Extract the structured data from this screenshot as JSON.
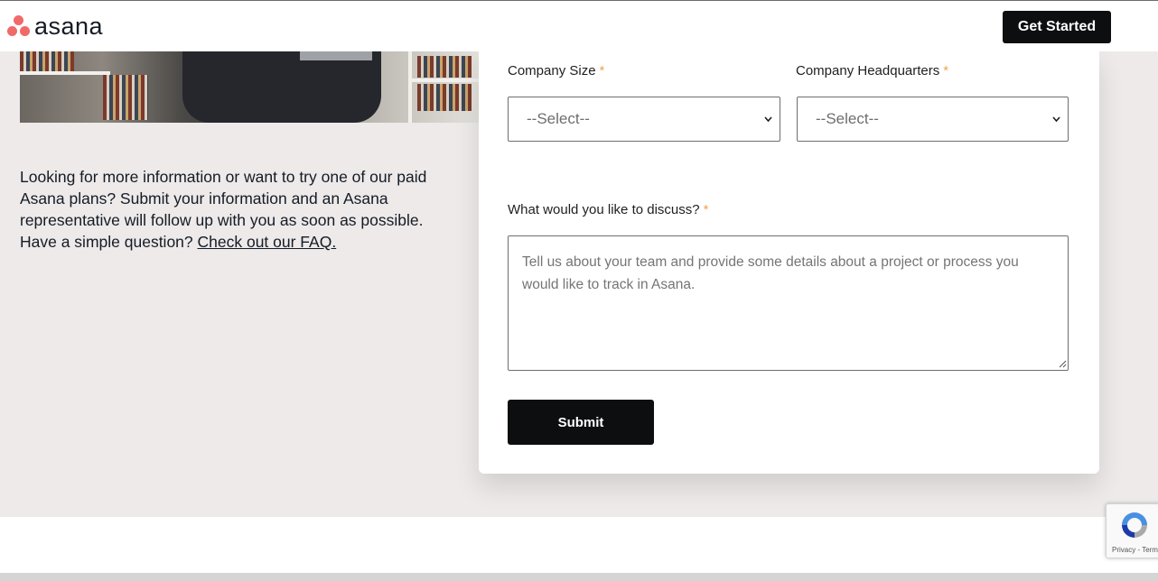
{
  "header": {
    "logo_text": "asana",
    "get_started_label": "Get Started"
  },
  "intro": {
    "text": "Looking for more information or want to try one of our paid Asana plans? Submit your information and an Asana representative will follow up with you as soon as possible. Have a simple question? ",
    "faq_link": "Check out our FAQ."
  },
  "form": {
    "company_size": {
      "label": "Company Size",
      "required_mark": "*",
      "selected": "--Select--"
    },
    "company_headquarters": {
      "label": "Company Headquarters",
      "required_mark": "*",
      "selected": "--Select--"
    },
    "discuss": {
      "label": "What would you like to discuss?",
      "required_mark": "*",
      "placeholder": "Tell us about your team and provide some details about a project or process you would like to track in Asana."
    },
    "submit_label": "Submit"
  },
  "recaptcha": {
    "footer_text": "Privacy - Terms"
  },
  "colors": {
    "brand_coral": "#f06a6a",
    "button_black": "#0d0e10",
    "required_orange": "#f1a34b",
    "page_beige": "#edeae9"
  }
}
